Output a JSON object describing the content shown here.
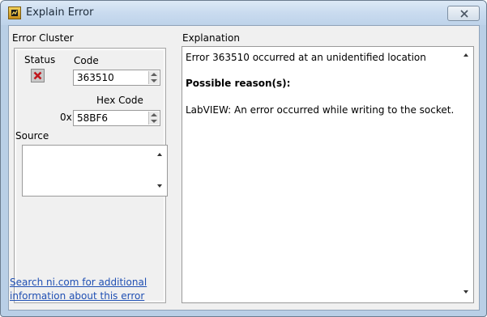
{
  "window": {
    "title": "Explain Error",
    "app_icon": "labview-icon",
    "close_icon": "close-icon"
  },
  "error_cluster": {
    "title": "Error Cluster",
    "status_label": "Status",
    "status_icon": "error-x-icon",
    "code_label": "Code",
    "code_value": "363510",
    "hex_label": "Hex Code",
    "hex_prefix": "0x",
    "hex_value": "58BF6",
    "source_label": "Source",
    "source_value": ""
  },
  "explanation": {
    "title": "Explanation",
    "line1": "Error 363510 occurred at an unidentified location",
    "heading": "Possible reason(s):",
    "line2": "LabVIEW:  An error occurred while writing to the socket."
  },
  "link": {
    "line1": "Search ni.com for additional",
    "line2": "information about this error"
  },
  "colors": {
    "title_bar": "#c9dbef",
    "link": "#1f4fb3",
    "error_x": "#c0171d"
  }
}
